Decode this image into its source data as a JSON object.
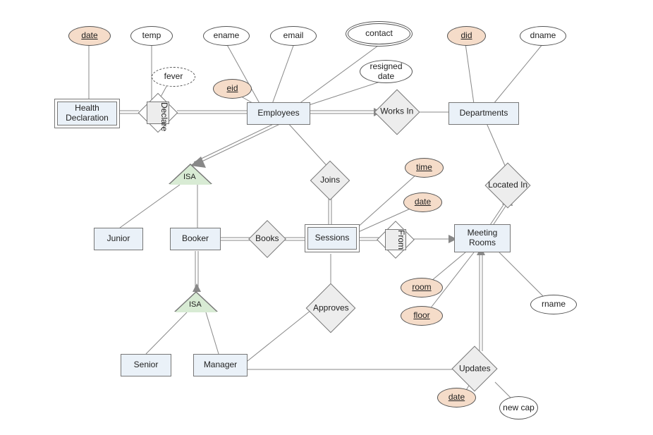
{
  "entities": {
    "healthdecl": "Health Declaration",
    "employees": "Employees",
    "departments": "Departments",
    "junior": "Junior",
    "booker": "Booker",
    "sessions": "Sessions",
    "meetingrooms": "Meeting Rooms",
    "senior": "Senior",
    "manager": "Manager"
  },
  "rels": {
    "declare": "Declare",
    "worksin": "Works In",
    "joins": "Joins",
    "locatedin": "Located In",
    "books": "Books",
    "from": "From",
    "approves": "Approves",
    "updates": "Updates"
  },
  "attrs": {
    "hd_date": "date",
    "hd_temp": "temp",
    "fever": "fever",
    "ename": "ename",
    "eid": "eid",
    "email": "email",
    "contact": "contact",
    "resigned": "resigned date",
    "did": "did",
    "dname": "dname",
    "time": "time",
    "sdate": "date",
    "room": "room",
    "floor": "floor",
    "rname": "rname",
    "udate": "date",
    "newcap": "new cap"
  },
  "special": {
    "isa": "ISA"
  }
}
